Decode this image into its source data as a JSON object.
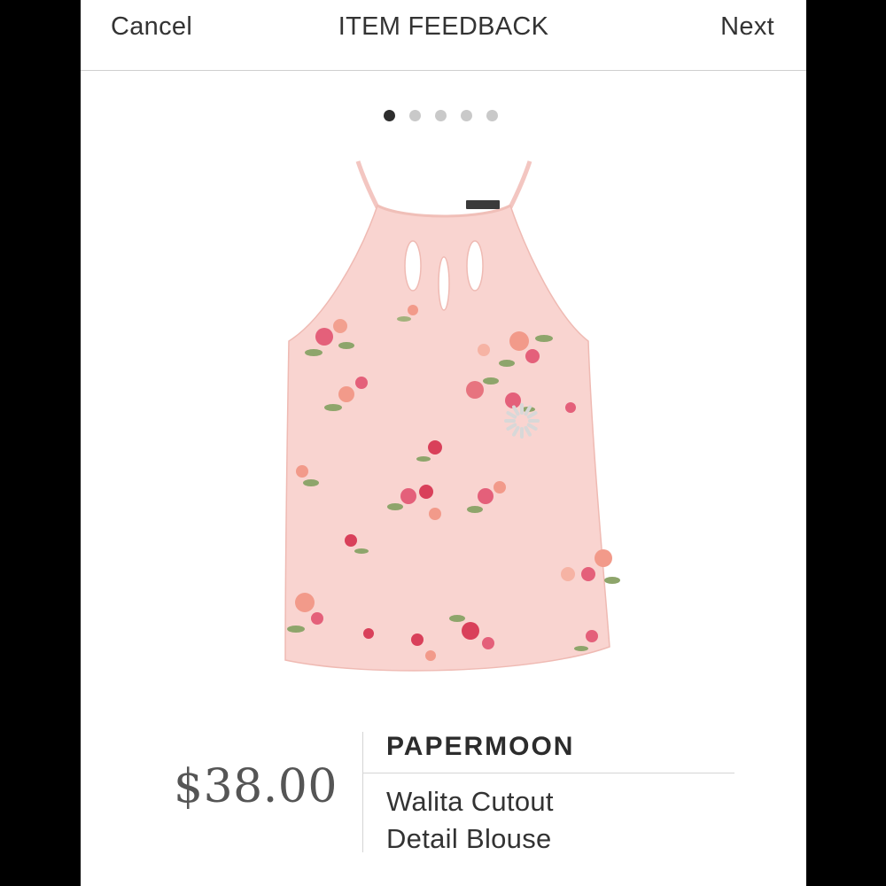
{
  "nav": {
    "cancel_label": "Cancel",
    "title": "ITEM FEEDBACK",
    "next_label": "Next"
  },
  "pager": {
    "count": 5,
    "active_index": 0
  },
  "product": {
    "image_alt": "Pink floral halter top",
    "garment_color": "#f9d4d0",
    "price": "$38.00",
    "brand": "PAPERMOON",
    "name_line1": "Walita Cutout",
    "name_line2": "Detail Blouse"
  },
  "colors": {
    "text": "#333333",
    "active_dot": "#2e2e2e",
    "inactive_dot": "#c9c9c9"
  }
}
